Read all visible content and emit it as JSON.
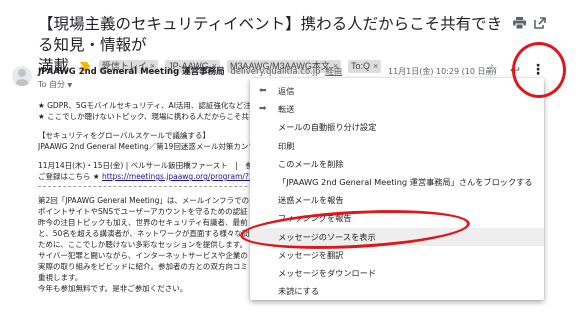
{
  "subject": {
    "line1": "【現場主義のセキュリティイベント】携わる人だからこそ共有できる知見・情報が",
    "line2": "満載",
    "labels": [
      "受信トレイ",
      "JP-AAWG",
      "M3AAWG/M3AAWG本文",
      "To:Q"
    ],
    "label_close": "×"
  },
  "header_icons": [
    "print-icon",
    "open-in-new-window-icon"
  ],
  "message": {
    "sender_name": "JPAAWG 2nd General Meeting 運営事務局",
    "sender_email": "delivery.qualitia.co.jp",
    "sender_note": "経由",
    "to": "To 自分",
    "to_caret": "▼",
    "date": "11月1日(金) 10:29 (10 日前)",
    "star": "☆",
    "reply": "↩",
    "more": "⋮"
  },
  "body": {
    "lines_a": [
      "★ GDPR、5Gモバイルセキュリティ、AI活用、認証強化など注",
      "★ ここでしか聴けないトピック、現場に携わる人だからこそ共"
    ],
    "lines_b": [
      "【セキュリティをグローバルスケールで議論する】",
      "JPAAWG 2nd General Meeting／第19回迷惑メール対策カンファ"
    ],
    "line_c1": "11月14日(木)・15日(金) | ベルサール飯田橋ファースト　|　参加",
    "line_c2_prefix": "ご登録はこちら ★ ",
    "line_c2_link": "https://meetings.jpaawg.org/program/?1P1sk",
    "lines_d": [
      "第2回「JPAAWG General Meeting」は、メールインフラでの",
      "ポイントサイトやSNSでユーザーアカウントを守るための認証",
      "昨今の注目トピックも加え、世界のセキュリティ有識者、最前",
      "と、50名を超える講演者が、ネットワークが直面する様々な問",
      "ために、ここでしか聴けない多彩なセッションを提供します。",
      "サイバー犯罪と闘いながら、インターネットサービスや企業の",
      "実際の取り組みをビビッドに紹介。参加者の方との双方向コミ",
      "重視します。",
      "今年も参加無料です。是非ご参加ください。"
    ]
  },
  "menu": {
    "items": [
      {
        "icon": "reply-icon",
        "glyph": "⬅",
        "label": "返信"
      },
      {
        "icon": "forward-icon",
        "glyph": "➡",
        "label": "転送"
      },
      {
        "icon": "",
        "glyph": "",
        "label": "メールの自動振り分け設定"
      },
      {
        "icon": "",
        "glyph": "",
        "label": "印刷"
      },
      {
        "icon": "",
        "glyph": "",
        "label": "このメールを削除"
      },
      {
        "icon": "",
        "glyph": "",
        "label": "「JPAAWG 2nd General Meeting 運営事務局」さんをブロックする"
      },
      {
        "icon": "",
        "glyph": "",
        "label": "迷惑メールを報告"
      },
      {
        "icon": "",
        "glyph": "",
        "label": "フィッシングを報告"
      },
      {
        "icon": "",
        "glyph": "",
        "label": "メッセージのソースを表示"
      },
      {
        "icon": "",
        "glyph": "",
        "label": "メッセージを翻訳"
      },
      {
        "icon": "",
        "glyph": "",
        "label": "メッセージをダウンロード"
      },
      {
        "icon": "",
        "glyph": "",
        "label": "未読にする"
      }
    ],
    "active_index": 8
  },
  "colors": {
    "annotation": "#e0161d",
    "important_marker": "#f4b400",
    "link": "#1a0dab",
    "menu_hover": "#eeeeee"
  }
}
